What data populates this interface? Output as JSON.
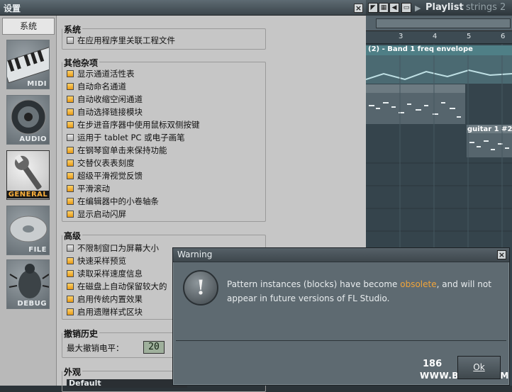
{
  "settings": {
    "title": "设置",
    "close_glyph": "×",
    "sidebar": {
      "header": "系统",
      "items": [
        {
          "label": "MIDI",
          "icon": "keyboard-icon"
        },
        {
          "label": "AUDIO",
          "icon": "speaker-icon"
        },
        {
          "label": "GENERAL",
          "icon": "wrench-icon"
        },
        {
          "label": "FILE",
          "icon": "disc-icon"
        },
        {
          "label": "DEBUG",
          "icon": "bug-icon"
        }
      ]
    },
    "groups": {
      "system": {
        "title": "系统",
        "items": [
          {
            "label": "在应用程序里关联工程文件",
            "checked": false
          }
        ]
      },
      "misc": {
        "title": "其他杂项",
        "items": [
          {
            "label": "显示通道活性表",
            "checked": true
          },
          {
            "label": "自动命名通道",
            "checked": true
          },
          {
            "label": "自动收缩空闲通道",
            "checked": true
          },
          {
            "label": "自动选择链接模块",
            "checked": true
          },
          {
            "label": "在步进音序器中使用鼠标双侧按键",
            "checked": true
          },
          {
            "label": "运用于 tablet PC 或电子画笔",
            "checked": false
          },
          {
            "label": "在钢琴窗单击来保持功能",
            "checked": true
          },
          {
            "label": "交替仪表表刻度",
            "checked": true
          },
          {
            "label": "超级平滑视觉反馈",
            "checked": true
          },
          {
            "label": "平滑滚动",
            "checked": true
          },
          {
            "label": "在编辑器中的小卷轴条",
            "checked": true
          },
          {
            "label": "显示启动闪屏",
            "checked": true
          }
        ]
      },
      "advanced": {
        "title": "高级",
        "items": [
          {
            "label": "不限制窗口为屏幕大小",
            "checked": false
          },
          {
            "label": "快速采样预览",
            "checked": true
          },
          {
            "label": "读取采样速度信息",
            "checked": true
          },
          {
            "label": "在磁盘上自动保留较大的",
            "checked": true
          },
          {
            "label": "启用传统内置效果",
            "checked": true
          },
          {
            "label": "启用遗赠样式区块",
            "checked": true
          }
        ]
      },
      "undo": {
        "title": "撤销历史",
        "max_label": "最大撤销电平：",
        "max_value": "20"
      },
      "appearance": {
        "title": "外观",
        "theme": "Default"
      }
    }
  },
  "playlist": {
    "title": "Playlist",
    "subtitle": "- strings 2",
    "ruler": [
      "3",
      "4",
      "5",
      "6"
    ],
    "envelope_label": "(2) - Band 1 freq envelope",
    "clip_label": "guitar 1 #2"
  },
  "warning": {
    "title": "Warning",
    "close_glyph": "×",
    "message_pre": "Pattern instances (blocks) have become ",
    "message_highlight": "obsolete",
    "message_post": ", and will not appear in future versions of FL Studio.",
    "ok_label": "Ok",
    "watermark_num": "186",
    "watermark_url": "WWW.BOI86.COM"
  }
}
